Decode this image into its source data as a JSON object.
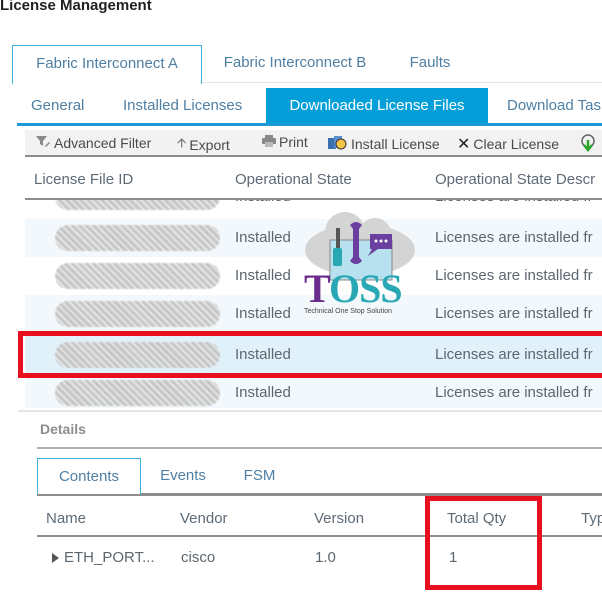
{
  "page": {
    "title": "License Management"
  },
  "top_tabs": [
    {
      "label": "Fabric Interconnect A",
      "active": true
    },
    {
      "label": "Fabric Interconnect B",
      "active": false
    },
    {
      "label": "Faults",
      "active": false
    }
  ],
  "sub_tabs": [
    {
      "label": "General",
      "active": false
    },
    {
      "label": "Installed Licenses",
      "active": false
    },
    {
      "label": "Downloaded License Files",
      "active": true
    },
    {
      "label": "Download Tas",
      "active": false
    }
  ],
  "toolbar": {
    "advanced_filter": "Advanced Filter",
    "export": "Export",
    "print": "Print",
    "install_license": "Install License",
    "clear_license": "Clear License"
  },
  "license_table": {
    "columns": [
      "License File ID",
      "Operational State",
      "Operational State Descr"
    ],
    "rows": [
      {
        "id": "",
        "state": "Installed",
        "description": "Licenses are installed fr",
        "selected": false
      },
      {
        "id": "",
        "state": "Installed",
        "description": "Licenses are installed fr",
        "selected": false
      },
      {
        "id": "",
        "state": "Installed",
        "description": "Licenses are installed fr",
        "selected": false
      },
      {
        "id": "",
        "state": "Installed",
        "description": "Licenses are installed fr",
        "selected": false
      },
      {
        "id": "",
        "state": "Installed",
        "description": "Licenses are installed fr",
        "selected": true
      },
      {
        "id": "",
        "state": "Installed",
        "description": "Licenses are installed fr",
        "selected": false
      }
    ]
  },
  "details": {
    "title": "Details",
    "tabs": [
      {
        "label": "Contents",
        "active": true
      },
      {
        "label": "Events",
        "active": false
      },
      {
        "label": "FSM",
        "active": false
      }
    ],
    "columns": [
      "Name",
      "Vendor",
      "Version",
      "Total Qty",
      "Typ"
    ],
    "rows": [
      {
        "name": "ETH_PORT...",
        "vendor": "cisco",
        "version": "1.0",
        "total_qty": "1",
        "type": ""
      }
    ]
  },
  "watermark": {
    "brand_t": "T",
    "brand_rest": "OSS",
    "tagline": "Technical One Stop Solution"
  },
  "colors": {
    "accent": "#049fd9",
    "highlight": "#e8101e",
    "link_text": "#4f7fa3"
  }
}
